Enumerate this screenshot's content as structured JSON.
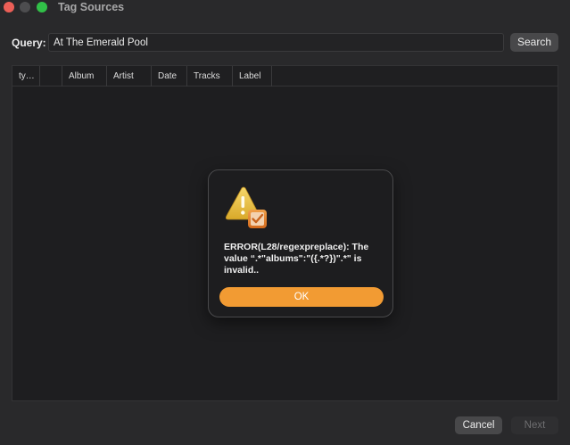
{
  "window": {
    "title": "Tag Sources",
    "controls": [
      "close",
      "minimize",
      "zoom"
    ]
  },
  "query": {
    "label": "Query:",
    "value": "At The Emerald Pool",
    "search_label": "Search"
  },
  "table": {
    "columns": [
      "ty…",
      "",
      "Album",
      "Artist",
      "Date",
      "Tracks",
      "Label"
    ],
    "rows": []
  },
  "dialog": {
    "icon": "warning-icon",
    "message": "ERROR(L28/regexpreplace): The value “.*\"albums\":\"({.*?})\".*\" is invalid..",
    "ok_label": "OK",
    "accent": "#f29b33"
  },
  "footer": {
    "cancel_label": "Cancel",
    "next_label": "Next"
  }
}
